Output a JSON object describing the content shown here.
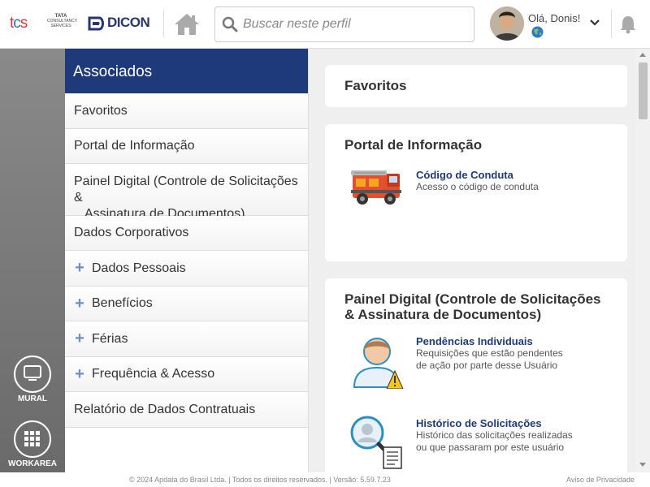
{
  "header": {
    "tcs_logo": {
      "mark": "tcs",
      "line1": "TATA",
      "line2": "CONSULTANCY",
      "line3": "SERVICES"
    },
    "dicon_logo": "DICON",
    "search_placeholder": "Buscar neste perfil",
    "greeting": "Olá, Donis!",
    "icons": [
      "home-icon",
      "search-icon",
      "globe-icon",
      "chevron-down-icon",
      "bell-icon"
    ]
  },
  "rail": {
    "items": [
      {
        "label": "MURAL",
        "icon": "monitor-icon"
      },
      {
        "label": "WORKAREA",
        "icon": "grid-icon"
      }
    ]
  },
  "menu": {
    "title": "Associados",
    "items": [
      {
        "label": "Favoritos"
      },
      {
        "label": "Portal de Informação"
      },
      {
        "label_line1": "Painel Digital (Controle de Solicitações &",
        "label_line2": "Assinatura de Documentos)"
      },
      {
        "label": "Dados Corporativos"
      },
      {
        "label": "Dados Pessoais",
        "expandable": true
      },
      {
        "label": "Benefícios",
        "expandable": true
      },
      {
        "label": "Férias",
        "expandable": true
      },
      {
        "label": "Frequência & Acesso",
        "expandable": true
      },
      {
        "label": "Relatório de Dados Contratuais"
      }
    ],
    "expand_glyph": "+"
  },
  "main": {
    "favoritos": {
      "title": "Favoritos"
    },
    "portal": {
      "title": "Portal de Informação",
      "links": [
        {
          "title": "Código de Conduta",
          "desc": "Acesso o código de conduta",
          "icon": "fire-truck-icon"
        }
      ]
    },
    "painel": {
      "title_line1": "Painel Digital (Controle de Solicitações",
      "title_line2": "& Assinatura de Documentos)",
      "links": [
        {
          "title": "Pendências Individuais",
          "desc_line1": "Requisições que estão pendentes",
          "desc_line2": "de ação por parte desse Usuário",
          "icon": "user-warning-icon"
        },
        {
          "title": "Histórico de Solicitações",
          "desc_line1": "Histórico das solicitações realizadas",
          "desc_line2": "ou que passaram por este usuário",
          "icon": "user-search-document-icon"
        }
      ]
    }
  },
  "footer": {
    "copyright": "© 2024 Apdata do Brasil Ltda. | Todos os direitos reservados. | Versão: 5.59.7.23",
    "privacy": "Aviso de Privacidade"
  },
  "colors": {
    "menu_header_bg": "#1f3a7a",
    "link_title": "#1f3a7a",
    "plus": "#6d8fc7",
    "rail": "#7a7a7a"
  }
}
